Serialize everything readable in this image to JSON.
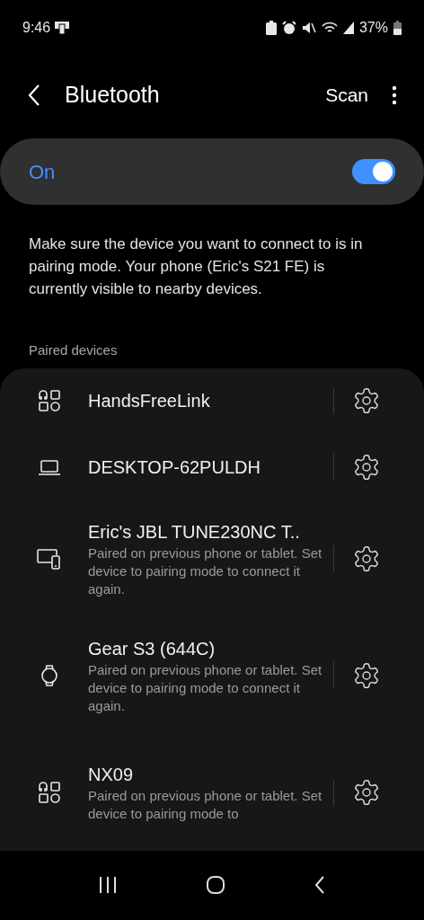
{
  "status_bar": {
    "time": "9:46",
    "battery": "37%"
  },
  "header": {
    "title": "Bluetooth",
    "action": "Scan"
  },
  "master_switch": {
    "label": "On",
    "on": true
  },
  "description": "Make sure the device you want to connect to is in pairing mode. Your phone (Eric's S21 FE) is currently visible to nearby devices.",
  "section_title": "Paired devices",
  "devices": [
    {
      "kind": "other",
      "name": "HandsFreeLink"
    },
    {
      "kind": "laptop",
      "name": "DESKTOP-62PULDH"
    },
    {
      "kind": "devices",
      "name": "Eric's JBL TUNE230NC T..",
      "subtitle": "Paired on previous phone or tablet. Set device to pairing mode to connect it again."
    },
    {
      "kind": "watch",
      "name": "Gear S3 (644C)",
      "subtitle": "Paired on previous phone or tablet. Set device to pairing mode to connect it again."
    },
    {
      "kind": "other",
      "name": "NX09",
      "subtitle": "Paired on previous phone or tablet. Set device to pairing mode to"
    }
  ]
}
